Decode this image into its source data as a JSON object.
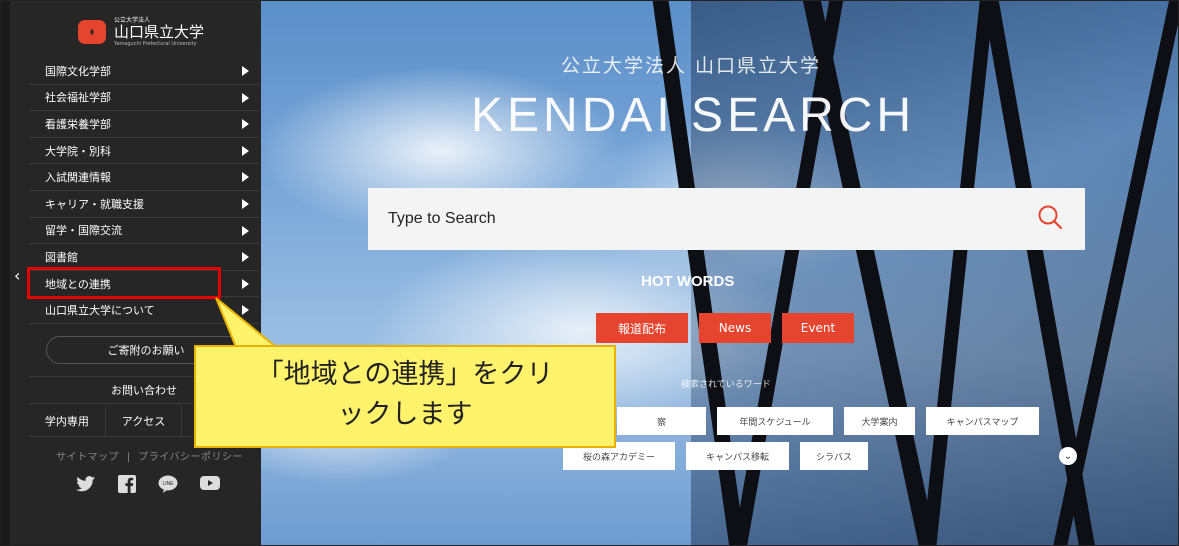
{
  "logo": {
    "small": "公立大学法人",
    "name": "山口県立大学",
    "english": "Yamaguchi Prefectural University"
  },
  "sidebar": {
    "items": [
      {
        "label": "国際文化学部"
      },
      {
        "label": "社会福祉学部"
      },
      {
        "label": "看護栄養学部"
      },
      {
        "label": "大学院・別科"
      },
      {
        "label": "入試関連情報"
      },
      {
        "label": "キャリア・就職支援"
      },
      {
        "label": "留学・国際交流"
      },
      {
        "label": "図書館"
      },
      {
        "label": "地域との連携"
      },
      {
        "label": "山口県立大学について"
      }
    ],
    "donate": "ご寄附のお願い",
    "contact": "お問い合わせ",
    "internal": "学内専用",
    "access": "アクセス",
    "sitemap": "サイトマップ",
    "separator": "|",
    "privacy": "プライバシーポリシー",
    "social_icons": [
      "twitter-icon",
      "facebook-icon",
      "line-icon",
      "youtube-icon"
    ]
  },
  "hero": {
    "subtitle": "公立大学法人 山口県立大学",
    "title": "KENDAI SEARCH",
    "search_placeholder": "Type to Search",
    "hot_words_label": "HOT WORDS",
    "tags": [
      "報道配布",
      "News",
      "Event"
    ],
    "popular_label": "検索されているワード",
    "pills_row1": [
      "察",
      "年間スケジュール",
      "大学案内",
      "キャンパスマップ"
    ],
    "pills_row2": [
      "桜の森アカデミー",
      "キャンパス移転",
      "シラバス"
    ]
  },
  "callout": {
    "line1": "「地域との連携」をクリ",
    "line2": "ックします"
  },
  "colors": {
    "accent": "#e5452e",
    "sidebar_bg": "#262626",
    "highlight": "#e30000",
    "callout_bg": "#fff36b"
  }
}
